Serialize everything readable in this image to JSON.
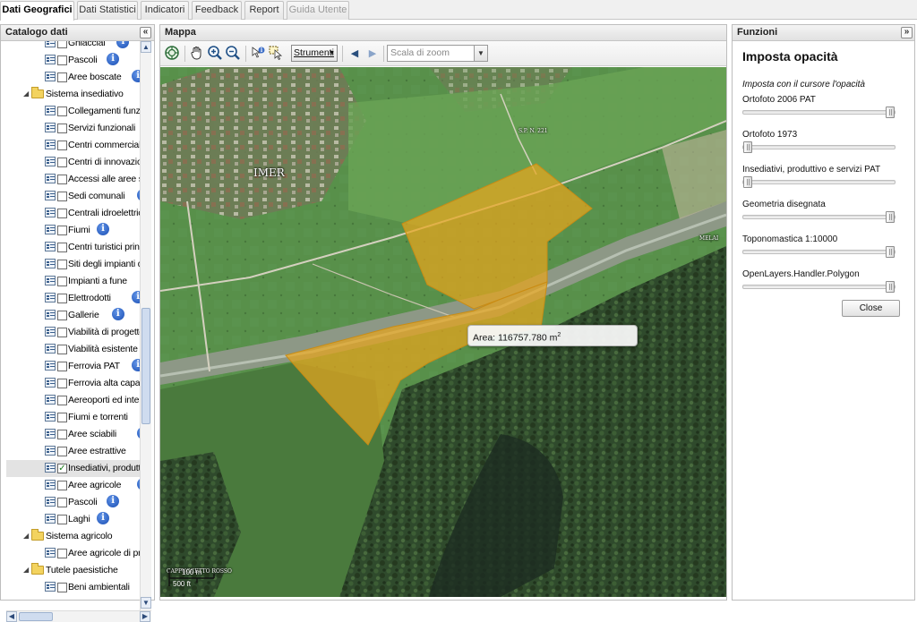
{
  "tabs": [
    {
      "label": "Dati Geografici",
      "state": "active"
    },
    {
      "label": "Dati Statistici",
      "state": "normal"
    },
    {
      "label": "Indicatori",
      "state": "normal"
    },
    {
      "label": "Feedback",
      "state": "normal"
    },
    {
      "label": "Report",
      "state": "normal"
    },
    {
      "label": "Guida Utente",
      "state": "disabled"
    }
  ],
  "catalog": {
    "title": "Catalogo dati",
    "collapse_icon": "double-chevron-left-icon",
    "items": [
      {
        "label": "Ghiacciai",
        "type": "layer",
        "info": true,
        "checked": false
      },
      {
        "label": "Pascoli",
        "type": "layer",
        "info": true,
        "checked": false
      },
      {
        "label": "Aree boscate",
        "type": "layer",
        "info": true,
        "checked": false
      },
      {
        "label": "Sistema insediativo",
        "type": "folder"
      },
      {
        "label": "Collegamenti funzio",
        "type": "layer",
        "info": false,
        "checked": false
      },
      {
        "label": "Servizi funzionali",
        "type": "layer",
        "info": true,
        "checked": false
      },
      {
        "label": "Centri commerciali ",
        "type": "layer",
        "info": false,
        "checked": false
      },
      {
        "label": "Centri di innovazion",
        "type": "layer",
        "info": false,
        "checked": false
      },
      {
        "label": "Accessi alle aree s",
        "type": "layer",
        "info": false,
        "checked": false
      },
      {
        "label": "Sedi comunali",
        "type": "layer",
        "info": true,
        "checked": false
      },
      {
        "label": "Centrali idroelettrich",
        "type": "layer",
        "info": false,
        "checked": false
      },
      {
        "label": "Fiumi",
        "type": "layer",
        "info": true,
        "checked": false
      },
      {
        "label": "Centri turistici princ",
        "type": "layer",
        "info": false,
        "checked": false
      },
      {
        "label": "Siti degli impianti di",
        "type": "layer",
        "info": false,
        "checked": false
      },
      {
        "label": "Impianti a fune",
        "type": "layer",
        "info": true,
        "checked": false
      },
      {
        "label": "Elettrodotti",
        "type": "layer",
        "info": true,
        "checked": false
      },
      {
        "label": "Gallerie",
        "type": "layer",
        "info": true,
        "checked": false
      },
      {
        "label": "Viabilità di progetto",
        "type": "layer",
        "info": false,
        "checked": false
      },
      {
        "label": "Viabilità esistente c",
        "type": "layer",
        "info": false,
        "checked": false
      },
      {
        "label": "Ferrovia PAT",
        "type": "layer",
        "info": true,
        "checked": false
      },
      {
        "label": "Ferrovia alta capac",
        "type": "layer",
        "info": false,
        "checked": false
      },
      {
        "label": "Aereoporti ed interp",
        "type": "layer",
        "info": false,
        "checked": false
      },
      {
        "label": "Fiumi e torrenti",
        "type": "layer",
        "info": true,
        "checked": false
      },
      {
        "label": "Aree sciabili",
        "type": "layer",
        "info": true,
        "checked": false
      },
      {
        "label": "Aree estrattive",
        "type": "layer",
        "info": true,
        "checked": false
      },
      {
        "label": "Insediativi, produttiv",
        "type": "layer",
        "info": false,
        "checked": true,
        "selected": true
      },
      {
        "label": "Aree agricole",
        "type": "layer",
        "info": true,
        "checked": false
      },
      {
        "label": "Pascoli",
        "type": "layer",
        "info": true,
        "checked": false
      },
      {
        "label": "Laghi",
        "type": "layer",
        "info": true,
        "checked": false
      },
      {
        "label": "Sistema agricolo",
        "type": "folder"
      },
      {
        "label": "Aree agricole di pre",
        "type": "layer",
        "info": false,
        "checked": false
      },
      {
        "label": "Tutele paesistiche",
        "type": "folder"
      },
      {
        "label": "Beni ambientali",
        "type": "layer",
        "info": true,
        "checked": false
      }
    ]
  },
  "map": {
    "title": "Mappa",
    "toolbar": {
      "strumenti_label": "Strumenti",
      "zoom_placeholder": "Scala di zoom",
      "icons": [
        "zoom-extent-icon",
        "pan-hand-icon",
        "zoom-in-icon",
        "zoom-out-icon",
        "info-query-icon",
        "select-features-icon",
        "back-arrow-icon",
        "forward-arrow-icon"
      ]
    },
    "place_labels": {
      "imer": "IMER",
      "road": "S.P. N. 221",
      "melai": "MELAI",
      "cappuccetto": "CAPPUCCETTO ROSSO"
    },
    "measure": {
      "prefix": "Area: 116757.780 m",
      "unit_superscript": "2"
    },
    "scale": {
      "meters": "100 m",
      "feet": "500 ft"
    },
    "polygon_color": "#e8a51d"
  },
  "functions": {
    "title": "Funzioni",
    "collapse_icon": "double-chevron-right-icon",
    "heading": "Imposta opacità",
    "note": "Imposta con il cursore l'opacità",
    "sliders": [
      {
        "label": "Ortofoto 2006 PAT",
        "value": 1.0
      },
      {
        "label": "Ortofoto 1973",
        "value": 0.0
      },
      {
        "label": "Insediativi, produttivo e servizi PAT",
        "value": 0.0
      },
      {
        "label": "Geometria disegnata",
        "value": 1.0
      },
      {
        "label": "Toponomastica 1:10000",
        "value": 1.0
      },
      {
        "label": "OpenLayers.Handler.Polygon",
        "value": 1.0
      }
    ],
    "close_label": "Close"
  }
}
